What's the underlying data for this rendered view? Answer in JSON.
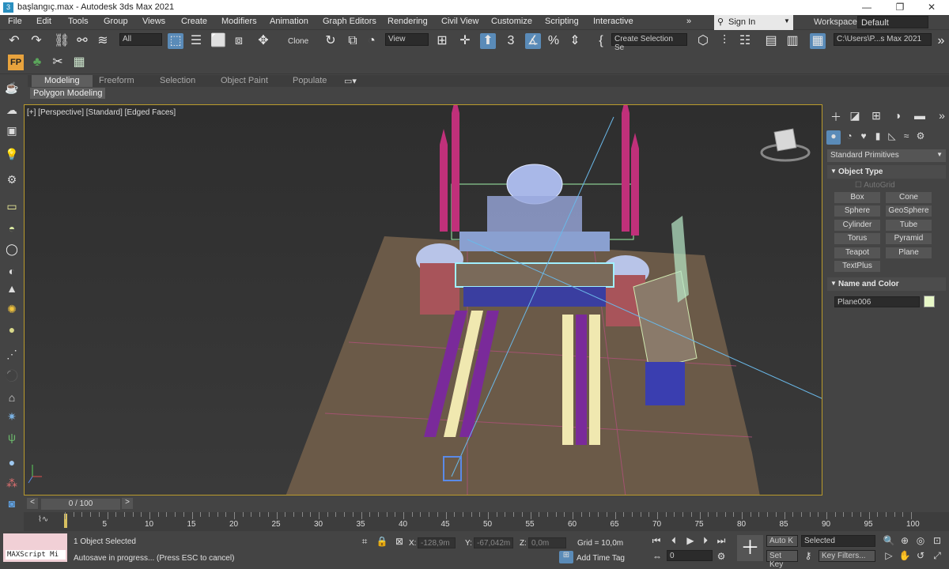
{
  "window": {
    "title": "başlangıç.max - Autodesk 3ds Max 2021",
    "minimize": "—",
    "maximize": "❐",
    "close": "✕"
  },
  "menu": {
    "items": [
      "File",
      "Edit",
      "Tools",
      "Group",
      "Views",
      "Create",
      "Modifiers",
      "Animation",
      "Graph Editors",
      "Rendering",
      "Civil View",
      "Customize",
      "Scripting",
      "Interactive"
    ],
    "more": "»",
    "signin": "Sign In",
    "workspaces_label": "Workspaces:",
    "workspace_value": "Default"
  },
  "toolbar": {
    "selection_filter": "All",
    "clone_label": "Clone",
    "ref_coord": "View",
    "selection_set": "Create Selection Se",
    "project_path": "C:\\Users\\P...s Max 2021"
  },
  "ribbon": {
    "tabs": [
      "Modeling",
      "Freeform",
      "Selection",
      "Object Paint",
      "Populate"
    ],
    "active_tab": "Modeling",
    "panel_label": "Polygon Modeling"
  },
  "viewport": {
    "label": "[+] [Perspective] [Standard] [Edged Faces]"
  },
  "command_panel": {
    "category": "Standard Primitives",
    "object_type_title": "Object Type",
    "autogrid": "AutoGrid",
    "primitives": [
      "Box",
      "Cone",
      "Sphere",
      "GeoSphere",
      "Cylinder",
      "Tube",
      "Torus",
      "Pyramid",
      "Teapot",
      "Plane",
      "TextPlus"
    ],
    "name_color_title": "Name and Color",
    "object_name": "Plane006",
    "object_color": "#e8f8c8"
  },
  "timeline": {
    "frame_display": "0 / 100",
    "ticks": [
      "5",
      "10",
      "15",
      "20",
      "25",
      "30",
      "35",
      "40",
      "45",
      "50",
      "55",
      "60",
      "65",
      "70",
      "75",
      "80",
      "85",
      "90",
      "95",
      "100"
    ]
  },
  "status": {
    "maxscript": "MAXScript Mi",
    "selection": "1 Object Selected",
    "prompt": "Autosave in progress... (Press ESC to cancel)",
    "x_label": "X:",
    "x_value": "-128,9m",
    "y_label": "Y:",
    "y_value": "-67,042m",
    "z_label": "Z:",
    "z_value": "0,0m",
    "grid": "Grid = 10,0m",
    "add_time_tag": "Add Time Tag",
    "auto_key": "Auto K",
    "set_key": "Set Key",
    "key_mode": "Selected",
    "key_filters": "Key Filters...",
    "frame": "0"
  }
}
